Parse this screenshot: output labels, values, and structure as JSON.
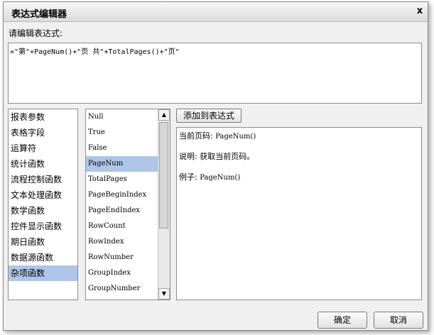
{
  "window": {
    "title": "表达式编辑器",
    "close_glyph": "x"
  },
  "prompt_label": "请编辑表达式:",
  "expression": "=\"第\"+PageNum()+\"页 共\"+TotalPages()+\"页\"",
  "categories": {
    "items": [
      "报表参数",
      "表格字段",
      "运算符",
      "统计函数",
      "流程控制函数",
      "文本处理函数",
      "数学函数",
      "控件显示函数",
      "期日函数",
      "数据源函数",
      "杂项函数"
    ],
    "selected": "杂项函数"
  },
  "functions": {
    "items": [
      "Null",
      "True",
      "False",
      "PageNum",
      "TotalPages",
      "PageBeginIndex",
      "PageEndIndex",
      "RowCount",
      "RowIndex",
      "RowNumber",
      "GroupIndex",
      "GroupNumber"
    ],
    "selected": "PageNum"
  },
  "add_button_label": "添加到表达式",
  "help": {
    "current_label": "当前页码:",
    "current_code": "PageNum()",
    "description_label": "说明:",
    "description_text": "获取当前页码。",
    "example_label": "例子:",
    "example_code": "PageNum()"
  },
  "footer": {
    "ok_label": "确定",
    "cancel_label": "取消"
  },
  "colors": {
    "selection": "#aec5e8",
    "dialog_bg": "#f0f0f0"
  }
}
